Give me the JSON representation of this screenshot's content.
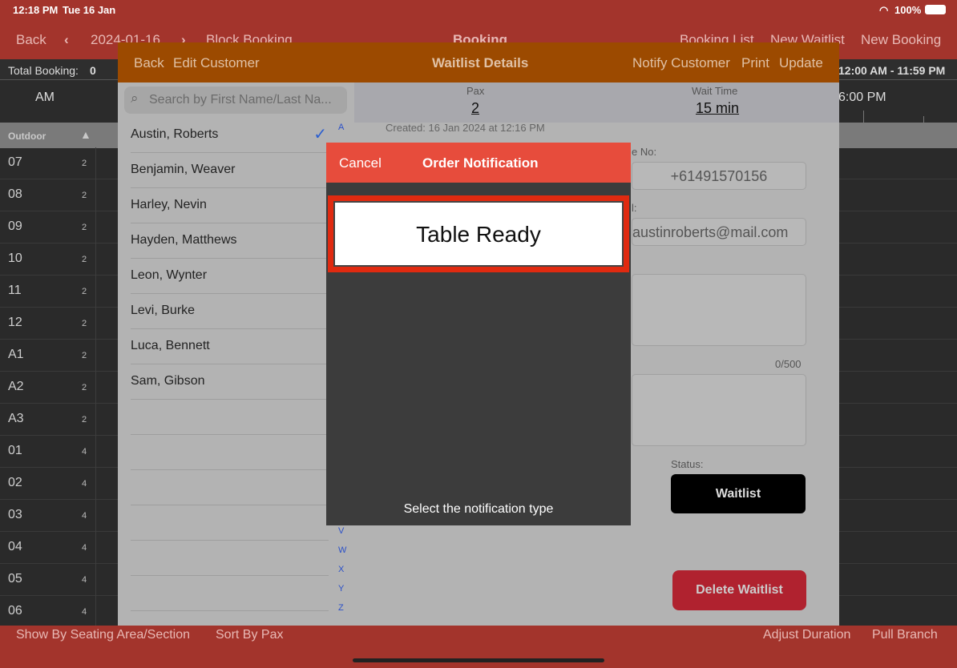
{
  "status_bar": {
    "time": "12:18 PM",
    "date": "Tue 16 Jan",
    "battery": "100%"
  },
  "nav": {
    "back": "Back",
    "date": "2024-01-16",
    "block_booking": "Block Booking",
    "title": "Booking",
    "booking_list": "Booking List",
    "new_waitlist": "New Waitlist",
    "new_booking": "New Booking"
  },
  "subbar": {
    "total_label": "Total Booking:",
    "total_value": "0",
    "time_range": "12:00 AM - 11:59 PM"
  },
  "timeline": {
    "left_label": "AM",
    "right_label": "6:00 PM"
  },
  "section": {
    "name": "Outdoor"
  },
  "tables": [
    {
      "name": "07",
      "pax": "2"
    },
    {
      "name": "08",
      "pax": "2"
    },
    {
      "name": "09",
      "pax": "2"
    },
    {
      "name": "10",
      "pax": "2"
    },
    {
      "name": "11",
      "pax": "2"
    },
    {
      "name": "12",
      "pax": "2"
    },
    {
      "name": "A1",
      "pax": "2"
    },
    {
      "name": "A2",
      "pax": "2"
    },
    {
      "name": "A3",
      "pax": "2"
    },
    {
      "name": "01",
      "pax": "4"
    },
    {
      "name": "02",
      "pax": "4"
    },
    {
      "name": "03",
      "pax": "4"
    },
    {
      "name": "04",
      "pax": "4"
    },
    {
      "name": "05",
      "pax": "4"
    },
    {
      "name": "06",
      "pax": "4"
    }
  ],
  "bottom": {
    "show_by": "Show By Seating Area/Section",
    "sort_by": "Sort By Pax",
    "adjust": "Adjust Duration",
    "pull": "Pull Branch"
  },
  "panel": {
    "back": "Back",
    "edit": "Edit Customer",
    "title": "Waitlist Details",
    "notify": "Notify Customer",
    "print": "Print",
    "update": "Update",
    "search_placeholder": "Search by First Name/Last Na...",
    "customers": [
      "Austin, Roberts",
      "Benjamin, Weaver",
      "Harley, Nevin",
      "Hayden, Matthews",
      "Leon, Wynter",
      "Levi, Burke",
      "Luca, Bennett",
      "Sam, Gibson"
    ],
    "index_letters": [
      "A",
      "V",
      "W",
      "X",
      "Y",
      "Z"
    ],
    "pax_label": "Pax",
    "pax_value": "2",
    "wait_label": "Wait Time",
    "wait_value": "15 min",
    "created": "Created: 16 Jan 2024 at 12:16 PM",
    "phone_label": "e No:",
    "phone_value": "+61491570156",
    "email_label": "l:",
    "email_value": "austinroberts@mail.com",
    "char_count": "0/500",
    "status_label": "Status:",
    "status_value": "Waitlist",
    "delete": "Delete Waitlist"
  },
  "popover": {
    "cancel": "Cancel",
    "title": "Order Notification",
    "option": "Table Ready",
    "hint": "Select the notification type"
  }
}
